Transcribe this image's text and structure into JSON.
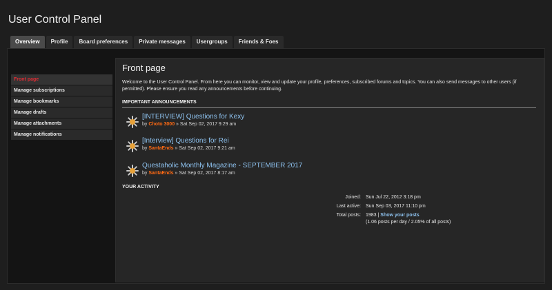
{
  "page": {
    "title": "User Control Panel"
  },
  "tabs": [
    {
      "label": "Overview",
      "active": true
    },
    {
      "label": "Profile"
    },
    {
      "label": "Board preferences"
    },
    {
      "label": "Private messages"
    },
    {
      "label": "Usergroups"
    },
    {
      "label": "Friends & Foes"
    }
  ],
  "sidebar": {
    "items": [
      {
        "label": "Front page",
        "active": true
      },
      {
        "label": "Manage subscriptions"
      },
      {
        "label": "Manage bookmarks"
      },
      {
        "label": "Manage drafts"
      },
      {
        "label": "Manage attachments"
      },
      {
        "label": "Manage notifications"
      }
    ]
  },
  "main": {
    "heading": "Front page",
    "welcome": "Welcome to the User Control Panel. From here you can monitor, view and update your profile, preferences, subscribed forums and topics. You can also send messages to other users (if permitted). Please ensure you read any announcements before continuing.",
    "announcements_heading": "IMPORTANT ANNOUNCEMENTS",
    "announcements": [
      {
        "title": "[INTERVIEW] Questions for Kexy",
        "by": "by",
        "author": "Choto 3000",
        "date": "» Sat Sep 02, 2017 9:29 am"
      },
      {
        "title": "[Interview] Questions for Rei",
        "by": "by",
        "author": "SantaEnds",
        "date": "» Sat Sep 02, 2017 9:21 am"
      },
      {
        "title": "Questaholic Monthly Magazine - SEPTEMBER 2017",
        "by": "by",
        "author": "SantaEnds",
        "date": "» Sat Sep 02, 2017 8:17 am"
      }
    ],
    "activity_heading": "YOUR ACTIVITY",
    "activity": {
      "joined_label": "Joined:",
      "joined_value": "Sun Jul 22, 2012 3:18 pm",
      "last_active_label": "Last active:",
      "last_active_value": "Sun Sep 03, 2017 11:10 pm",
      "total_posts_label": "Total posts:",
      "total_posts_value": "1983",
      "separator": " | ",
      "show_posts_link": "Show your posts",
      "posts_stats": "(1.06 posts per day / 2.05% of all posts)"
    }
  },
  "colors": {
    "accent_red": "#e02d35",
    "link_blue": "#8ec2ef",
    "author_orange": "#ff6a13"
  },
  "icons": {
    "announcement": "star-announcement-icon"
  }
}
